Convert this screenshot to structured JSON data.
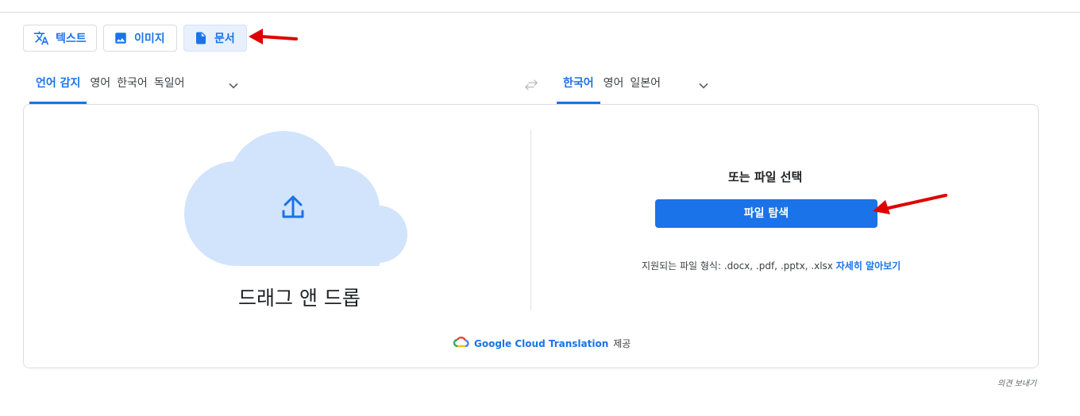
{
  "mode_tabs": [
    {
      "label": "텍스트",
      "icon": "translate-icon"
    },
    {
      "label": "이미지",
      "icon": "image-icon"
    },
    {
      "label": "문서",
      "icon": "document-icon",
      "active": true
    }
  ],
  "source_languages": [
    {
      "label": "언어 감지",
      "active": true
    },
    {
      "label": "영어"
    },
    {
      "label": "한국어"
    },
    {
      "label": "독일어"
    }
  ],
  "target_languages": [
    {
      "label": "한국어",
      "active": true
    },
    {
      "label": "영어"
    },
    {
      "label": "일본어"
    }
  ],
  "upload": {
    "drag_label": "드래그 앤 드롭",
    "or_label": "또는 파일 선택",
    "browse_label": "파일 탐색",
    "formats_text": "지원되는 파일 형식: .docx, .pdf, .pptx, .xlsx",
    "learn_more": "자세히 알아보기"
  },
  "credit": {
    "brand": "Google Cloud Translation",
    "suffix": "제공"
  },
  "feedback_label": "의견 보내기",
  "colors": {
    "accent": "#1a73e8",
    "cloud": "#d2e3fc",
    "annotation_arrow": "#e00000"
  }
}
